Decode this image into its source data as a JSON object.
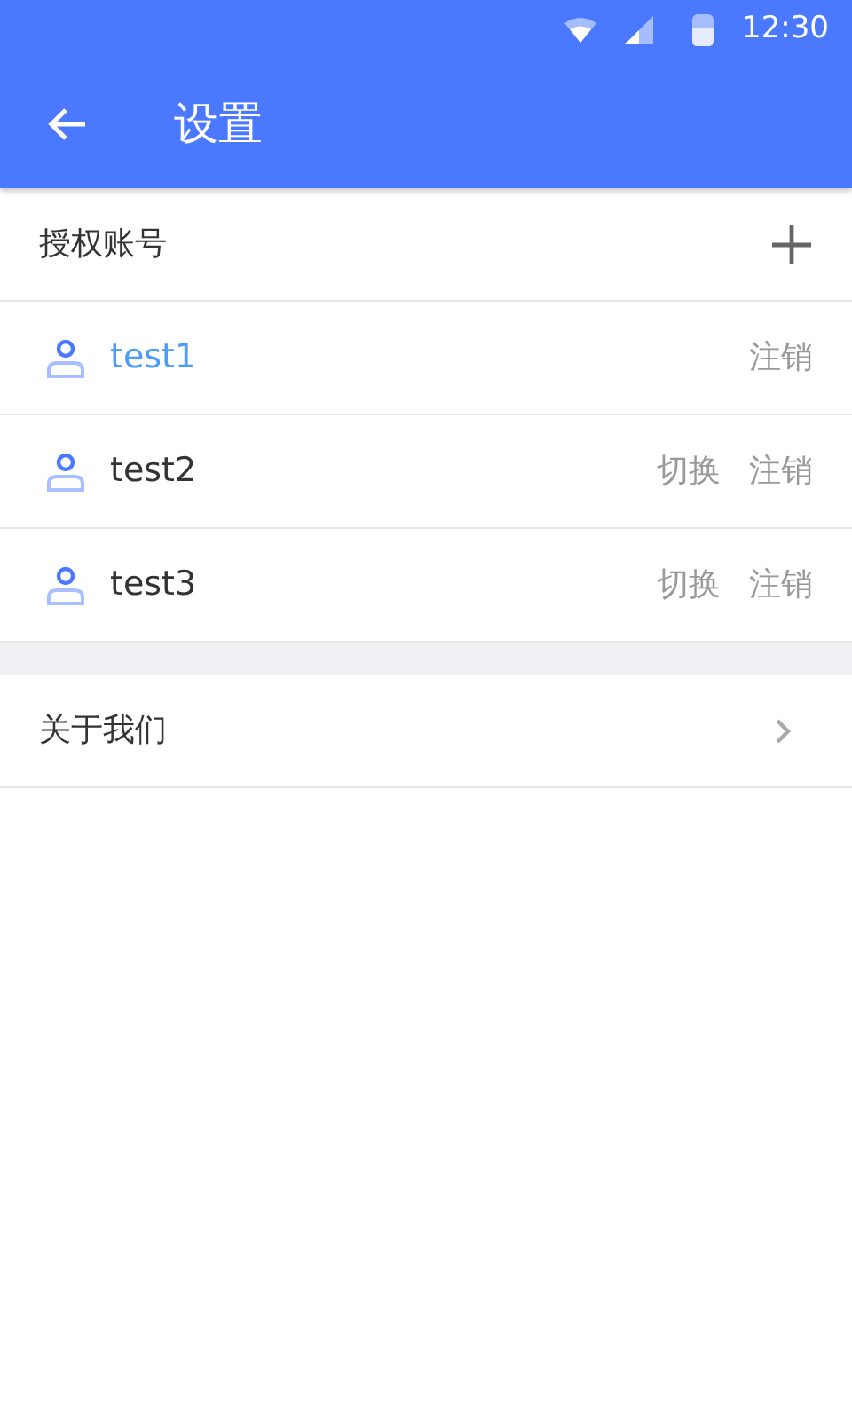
{
  "status_bar": {
    "time": "12:30"
  },
  "app_bar": {
    "title": "设置"
  },
  "accounts_section": {
    "title": "授权账号"
  },
  "accounts": [
    {
      "name": "test1",
      "selected": true,
      "actions": [
        "注销"
      ]
    },
    {
      "name": "test2",
      "selected": false,
      "actions": [
        "切换",
        "注销"
      ]
    },
    {
      "name": "test3",
      "selected": false,
      "actions": [
        "切换",
        "注销"
      ]
    }
  ],
  "menu": [
    {
      "label": "关于我们"
    }
  ]
}
